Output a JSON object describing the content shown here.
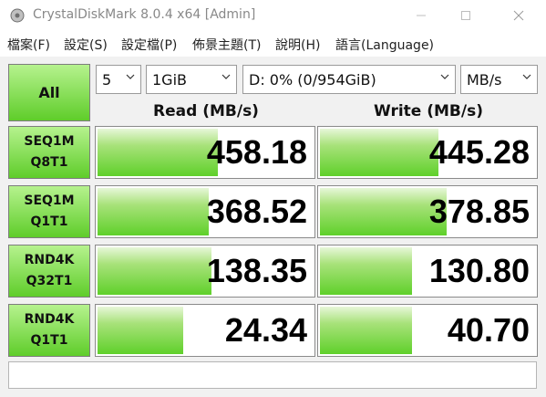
{
  "window": {
    "title": "CrystalDiskMark 8.0.4 x64 [Admin]"
  },
  "menu": [
    "檔案(F)",
    "設定(S)",
    "設定檔(P)",
    "佈景主題(T)",
    "說明(H)",
    "語言(Language)"
  ],
  "controls": {
    "all_label": "All",
    "count": "5",
    "size": "1GiB",
    "drive": "D: 0% (0/954GiB)",
    "unit": "MB/s"
  },
  "headers": {
    "read": "Read (MB/s)",
    "write": "Write (MB/s)"
  },
  "tests": [
    {
      "line1": "SEQ1M",
      "line2": "Q8T1",
      "read": "458.18",
      "write": "445.28",
      "read_fill": 0.55,
      "write_fill": 0.54
    },
    {
      "line1": "SEQ1M",
      "line2": "Q1T1",
      "read": "368.52",
      "write": "378.85",
      "read_fill": 0.51,
      "write_fill": 0.58
    },
    {
      "line1": "RND4K",
      "line2": "Q32T1",
      "read": "138.35",
      "write": "130.80",
      "read_fill": 0.52,
      "write_fill": 0.42
    },
    {
      "line1": "RND4K",
      "line2": "Q1T1",
      "read": "24.34",
      "write": "40.70",
      "read_fill": 0.39,
      "write_fill": 0.42
    }
  ],
  "status_text": "",
  "colors": {
    "accent_green": "#5fcd2a",
    "fill_light": "#e7f7d9"
  }
}
